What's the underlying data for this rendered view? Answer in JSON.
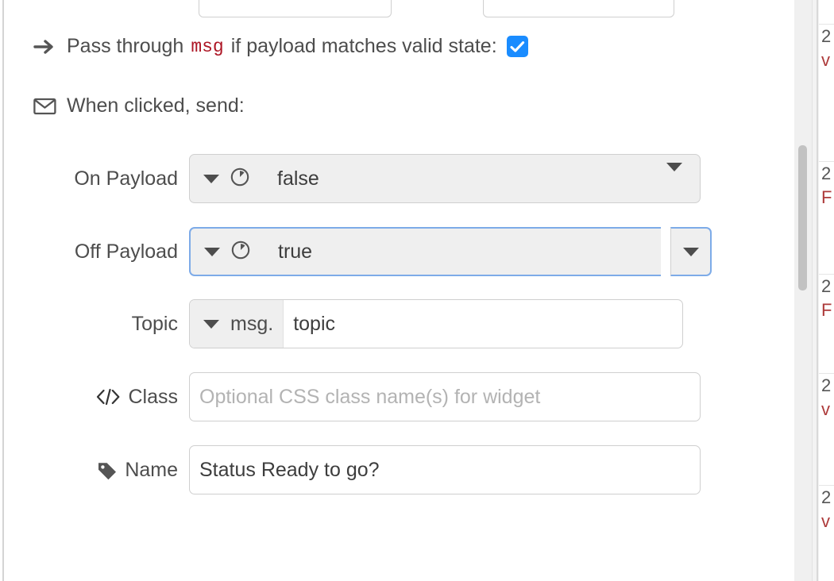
{
  "dialog": {
    "pass_through": {
      "icon": "arrow-right-icon",
      "text_before": "Pass through",
      "code_token": "msg",
      "text_after": "if payload matches valid state:",
      "checkbox_checked": true,
      "checkbox_color": "#1a8cff"
    },
    "when_clicked": {
      "icon": "envelope-icon",
      "text": "When clicked, send:"
    },
    "rows": [
      {
        "label": "On Payload",
        "type_icon": "boolean-type-icon",
        "value": "false",
        "focused": false
      },
      {
        "label": "Off Payload",
        "type_icon": "boolean-type-icon",
        "value": "true",
        "focused": true
      }
    ],
    "topic": {
      "label": "Topic",
      "prefix": "msg.",
      "value": "topic"
    },
    "class": {
      "label": "Class",
      "icon": "code-icon",
      "value": "",
      "placeholder": "Optional CSS class name(s) for widget"
    },
    "name": {
      "label": "Name",
      "icon": "tag-icon",
      "value": "Status Ready to go?",
      "placeholder": "Name"
    }
  },
  "sidebar": {
    "scrollbar": "vertical-scrollbar",
    "entries": [
      {
        "time": "2",
        "message": "v"
      },
      {
        "time": "2",
        "message": "F"
      },
      {
        "time": "2",
        "message": "F"
      },
      {
        "time": "2",
        "message": "v"
      },
      {
        "time": "2",
        "message": "v"
      }
    ]
  }
}
